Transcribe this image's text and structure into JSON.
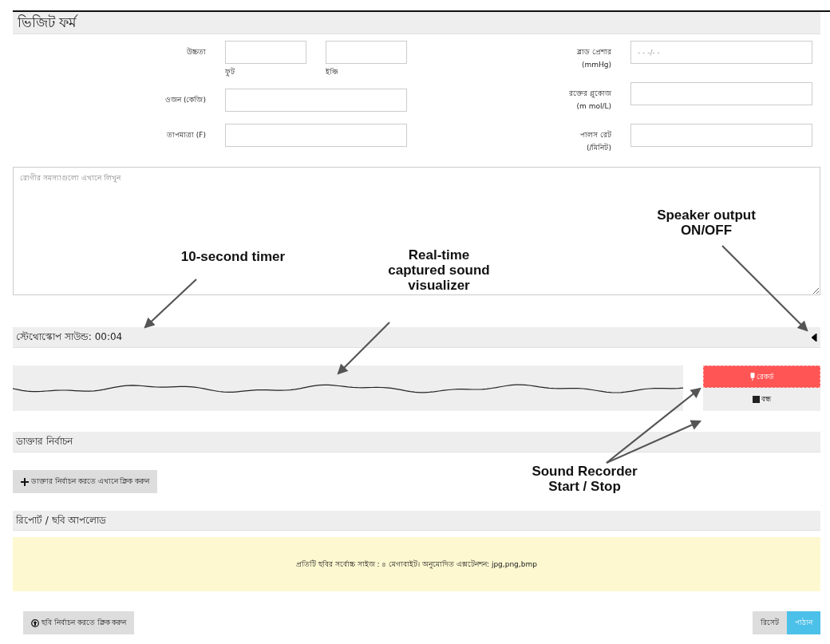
{
  "title": "ভিজিট ফর্ম",
  "left_fields": [
    {
      "label": "উচ্চতা",
      "kind": "split",
      "inputs": [
        {
          "sublabel": "ফুট"
        },
        {
          "sublabel": "ইঞ্চি"
        }
      ]
    },
    {
      "label": "ওজন (কেজি)",
      "kind": "single"
    },
    {
      "label": "তাপমাত্রা (F)",
      "kind": "single"
    }
  ],
  "right_fields": [
    {
      "label": "ব্লাড প্রেশার",
      "unit": "(mmHg)",
      "placeholder": "- - -/- -"
    },
    {
      "label": "রক্তের গ্লুকোজ",
      "unit": "(m mol/L)"
    },
    {
      "label": "পালস রেট",
      "unit": "(/মিনিট)"
    }
  ],
  "problems": {
    "placeholder": "রোগীর সমস্যাগুলো এখানে লিখুন"
  },
  "stethoscope": {
    "label": "স্টেথোস্কোপ সাউন্ড: 00:04",
    "speaker_on": true,
    "recording": true,
    "record_button": "রেকর্ড",
    "stop_button": "বন্ধ"
  },
  "doctor": {
    "heading": "ডাক্তার নির্বাচন",
    "button": "ডাক্তার নির্বাচন করতে এখানে ক্লিক করুন"
  },
  "upload": {
    "heading": "রিপোর্ট / ছবি আপলোড",
    "notice": "প্রতিটি ছবির সর্বোচ্চ সাইজ : ৪ মেগাবাইট। অনুমোদিত এক্সটেনশন: jpg,png,bmp",
    "button": "ছবি নির্বাচন করতে ক্লিক করুন"
  },
  "actions": [
    {
      "label": "রিসেট",
      "kind": "secondary"
    },
    {
      "label": "পাঠান",
      "kind": "primary"
    }
  ],
  "annotations": [
    {
      "lines": [
        "10-second timer"
      ]
    },
    {
      "lines": [
        "Real-time",
        "captured sound",
        "visualizer"
      ]
    },
    {
      "lines": [
        "Speaker output",
        "ON/OFF"
      ]
    },
    {
      "lines": [
        "Sound Recorder",
        "Start / Stop"
      ]
    }
  ]
}
